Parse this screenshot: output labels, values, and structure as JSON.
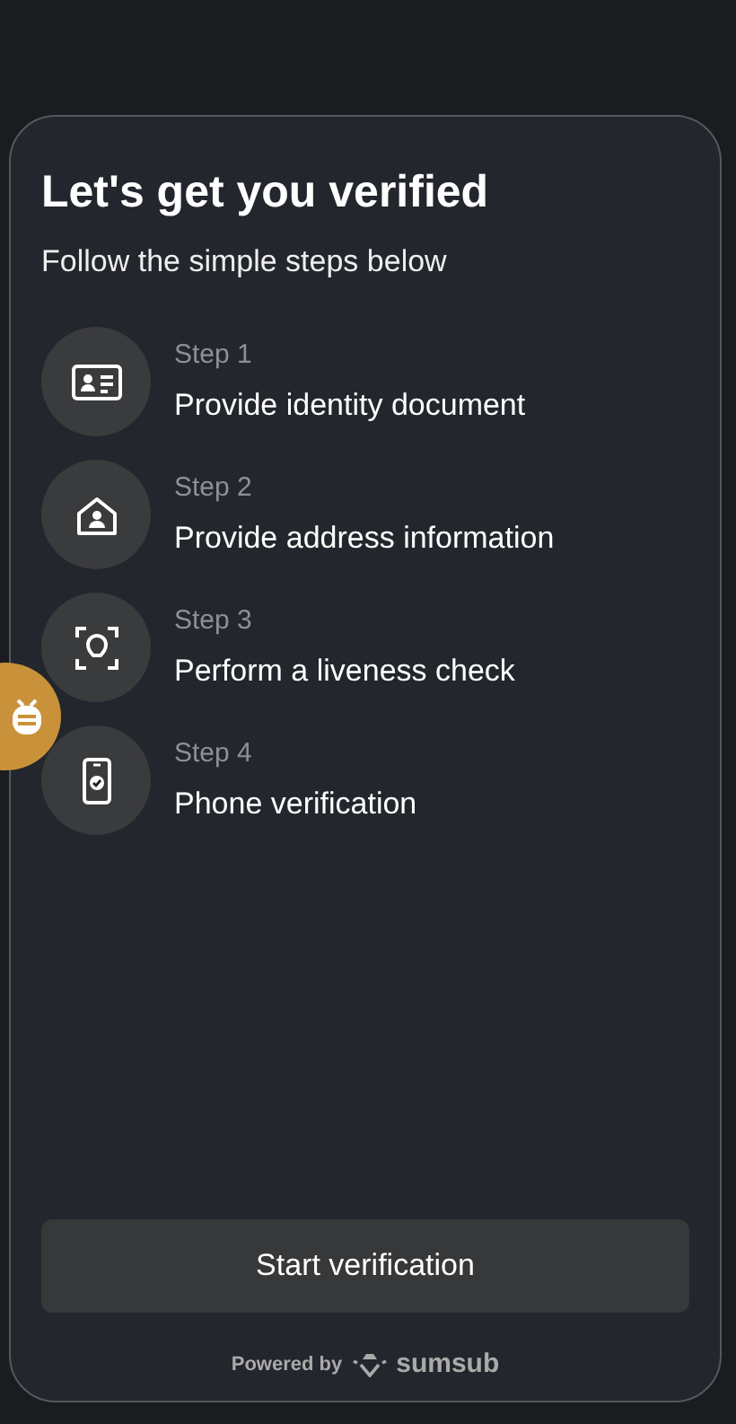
{
  "title": "Let's get you verified",
  "subtitle": "Follow the simple steps below",
  "steps": [
    {
      "kind": "id",
      "step": "Step 1",
      "label": "Provide identity document"
    },
    {
      "kind": "home",
      "step": "Step 2",
      "label": "Provide address information"
    },
    {
      "kind": "face",
      "step": "Step 3",
      "label": "Perform a liveness check"
    },
    {
      "kind": "phone",
      "step": "Step 4",
      "label": "Phone verification"
    }
  ],
  "button": "Start verification",
  "footer": {
    "powered": "Powered by",
    "brand": "sumsub"
  }
}
